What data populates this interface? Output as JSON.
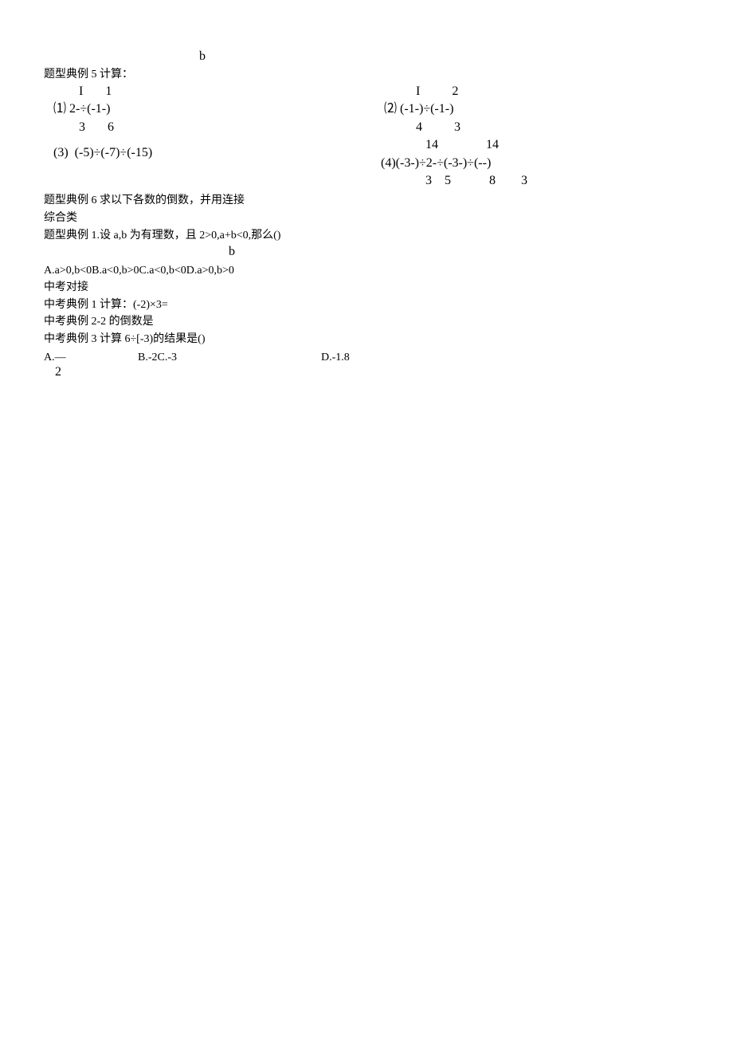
{
  "top_b": "b",
  "tixing5_title": "题型典例 5 计算：",
  "problems_row1": {
    "p1_line1": "           I       1",
    "p1_line2": "   ⑴ 2-÷(-1-)",
    "p1_line3": "           3       6",
    "p2_line1": "             I          2",
    "p2_line2": "   ⑵ (-1-)÷(-1-)",
    "p2_line3": "             4          3"
  },
  "problems_row2": {
    "p3": "   (3)  (-5)÷(-7)÷(-15)",
    "p4_line1": "                14               14",
    "p4_line2": "  (4)(-3-)÷2-÷(-3-)÷(--)",
    "p4_line3": "                3    5            8        3"
  },
  "tixing6": "题型典例 6 求以下各数的倒数，并用连接",
  "zonghe": "综合类",
  "tixing1_line1": "题型典例 1.设 a,b 为有理数，且 2>0,a+b<0,那么()",
  "sub_b": "b",
  "options_abcd": "A.a>0,b<0B.a<0,b>0C.a<0,b<0D.a>0,b>0",
  "zhongkao": "中考对接",
  "zk1": "中考典例 1 计算：(-2)×3=",
  "zk2": "中考典例 2-2 的倒数是",
  "zk3": "中考典例 3 计算 6÷[-3)的结果是()",
  "zk3_options": {
    "a": "A.—",
    "a_frac": "2",
    "b": "B.-2C.-3",
    "d": "D.-1.8"
  }
}
